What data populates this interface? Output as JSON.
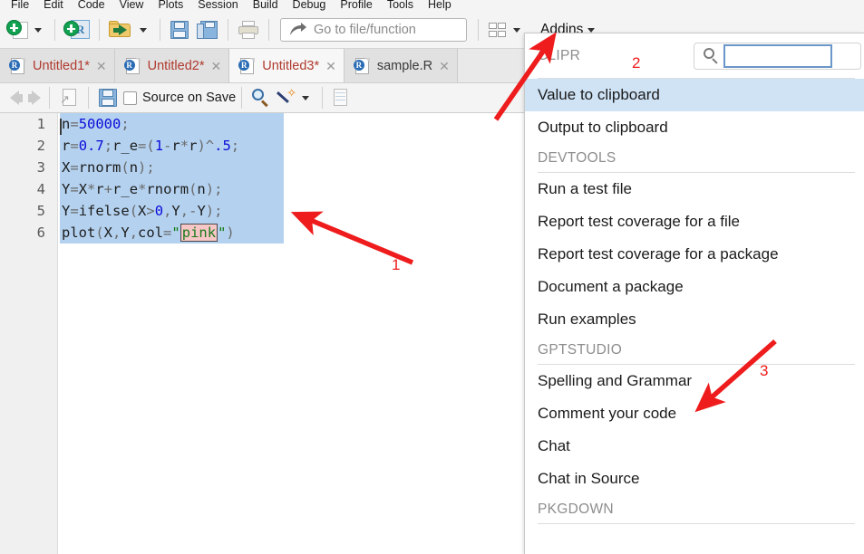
{
  "menubar": {
    "items": [
      "File",
      "Edit",
      "Code",
      "View",
      "Plots",
      "Session",
      "Build",
      "Debug",
      "Profile",
      "Tools",
      "Help"
    ]
  },
  "toolbar": {
    "new_file_icon": "new-file-icon",
    "new_project_icon": "new-project-icon",
    "open_file_icon": "open-file-icon",
    "save_icon": "save-icon",
    "save_all_icon": "save-all-icon",
    "print_icon": "print-icon",
    "goto_placeholder": "Go to file/function",
    "panes_icon": "pane-layout-icon",
    "addins_label": "Addins"
  },
  "tabs": [
    {
      "label": "Untitled1*",
      "modified": true,
      "active": false
    },
    {
      "label": "Untitled2*",
      "modified": true,
      "active": false
    },
    {
      "label": "Untitled3*",
      "modified": true,
      "active": true
    },
    {
      "label": "sample.R",
      "modified": false,
      "active": false
    }
  ],
  "editor_toolbar": {
    "back_icon": "back-arrow-icon",
    "forward_icon": "forward-arrow-icon",
    "popout_icon": "show-in-new-window-icon",
    "save_icon": "save-icon",
    "source_on_save_label": "Source on Save",
    "find_icon": "find-replace-icon",
    "magic_icon": "code-tools-icon",
    "compile_icon": "compile-report-icon"
  },
  "editor": {
    "lines": [
      {
        "num": "1",
        "code": "n=50000;"
      },
      {
        "num": "2",
        "code": "r=0.7;r_e=(1-r*r)^.5;"
      },
      {
        "num": "3",
        "code": "X=rnorm(n);"
      },
      {
        "num": "4",
        "code": "Y=X*r+r_e*rnorm(n);"
      },
      {
        "num": "5",
        "code": "Y=ifelse(X>0,Y,-Y);"
      },
      {
        "num": "6",
        "code": "plot(X,Y,col=\"pink\")"
      }
    ],
    "highlighted_token": "pink",
    "selection_color": "#b4d2f0",
    "token_highlight_color": "#f7c6c6"
  },
  "addins_panel": {
    "search_value": "",
    "search_placeholder": "",
    "groups": [
      {
        "name": "CLIPR",
        "items": [
          {
            "label": "Value to clipboard",
            "selected": true
          },
          {
            "label": "Output to clipboard",
            "selected": false
          }
        ]
      },
      {
        "name": "DEVTOOLS",
        "items": [
          {
            "label": "Run a test file",
            "selected": false
          },
          {
            "label": "Report test coverage for a file",
            "selected": false
          },
          {
            "label": "Report test coverage for a package",
            "selected": false
          },
          {
            "label": "Document a package",
            "selected": false
          },
          {
            "label": "Run examples",
            "selected": false
          }
        ]
      },
      {
        "name": "GPTSTUDIO",
        "items": [
          {
            "label": "Spelling and Grammar",
            "selected": false
          },
          {
            "label": "Comment your code",
            "selected": false
          },
          {
            "label": "Chat",
            "selected": false
          },
          {
            "label": "Chat in Source",
            "selected": false
          }
        ]
      },
      {
        "name": "PKGDOWN",
        "items": []
      }
    ]
  },
  "annotations": {
    "color": "#ee1c1c",
    "markers": [
      {
        "id": "1",
        "label": "1",
        "target": "code-selection"
      },
      {
        "id": "2",
        "label": "2",
        "target": "addins-button"
      },
      {
        "id": "3",
        "label": "3",
        "target": "spelling-and-grammar-item"
      }
    ]
  }
}
